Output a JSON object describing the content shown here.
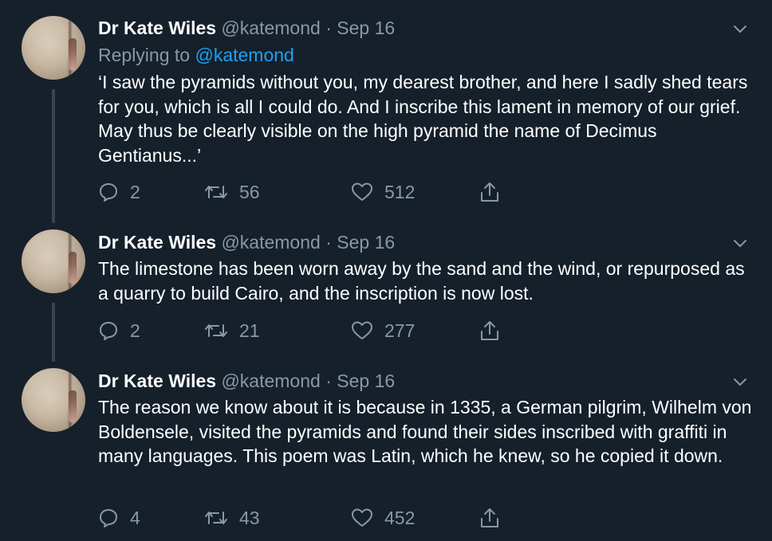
{
  "tweets": [
    {
      "author": {
        "display_name": "Dr Kate Wiles",
        "handle": "@katemond"
      },
      "separator": "·",
      "date": "Sep 16",
      "replying_prefix": "Replying to",
      "replying_mention": "@katemond",
      "text": "‘I saw the pyramids without you, my dearest brother, and here I sadly shed tears for you, which is all I could do. And I inscribe this lament in memory of our grief. May thus be clearly visible on the high pyramid the name of Decimus Gentianus...’",
      "replies": "2",
      "retweets": "56",
      "likes": "512"
    },
    {
      "author": {
        "display_name": "Dr Kate Wiles",
        "handle": "@katemond"
      },
      "separator": "·",
      "date": "Sep 16",
      "text": "The limestone has been worn away by the sand and the wind, or repurposed as a quarry to build Cairo, and the inscription is now lost.",
      "replies": "2",
      "retweets": "21",
      "likes": "277"
    },
    {
      "author": {
        "display_name": "Dr Kate Wiles",
        "handle": "@katemond"
      },
      "separator": "·",
      "date": "Sep 16",
      "text": "The reason we know about it is because in 1335, a German pilgrim, Wilhelm von Boldensele, visited the pyramids and found their sides inscribed with graffiti in many languages. This poem was Latin, which he knew, so he copied it down.",
      "replies": "4",
      "retweets": "43",
      "likes": "452"
    }
  ],
  "icons": {
    "reply": "speech-bubble-icon",
    "retweet": "retweet-arrows-icon",
    "like": "heart-outline-icon",
    "share": "share-upload-icon",
    "menu": "chevron-down-icon"
  },
  "colors": {
    "background": "#15202b",
    "primary_text": "#ffffff",
    "secondary_text": "#8899a6",
    "link": "#1da1f2",
    "thread_line": "#38444d"
  }
}
